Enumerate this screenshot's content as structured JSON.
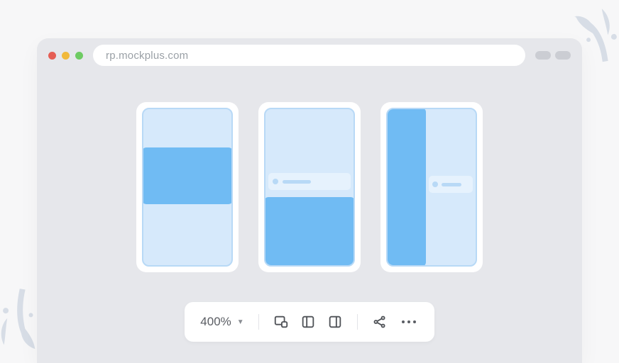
{
  "browser": {
    "url": "rp.mockplus.com"
  },
  "toolbar": {
    "zoom_label": "400%"
  }
}
